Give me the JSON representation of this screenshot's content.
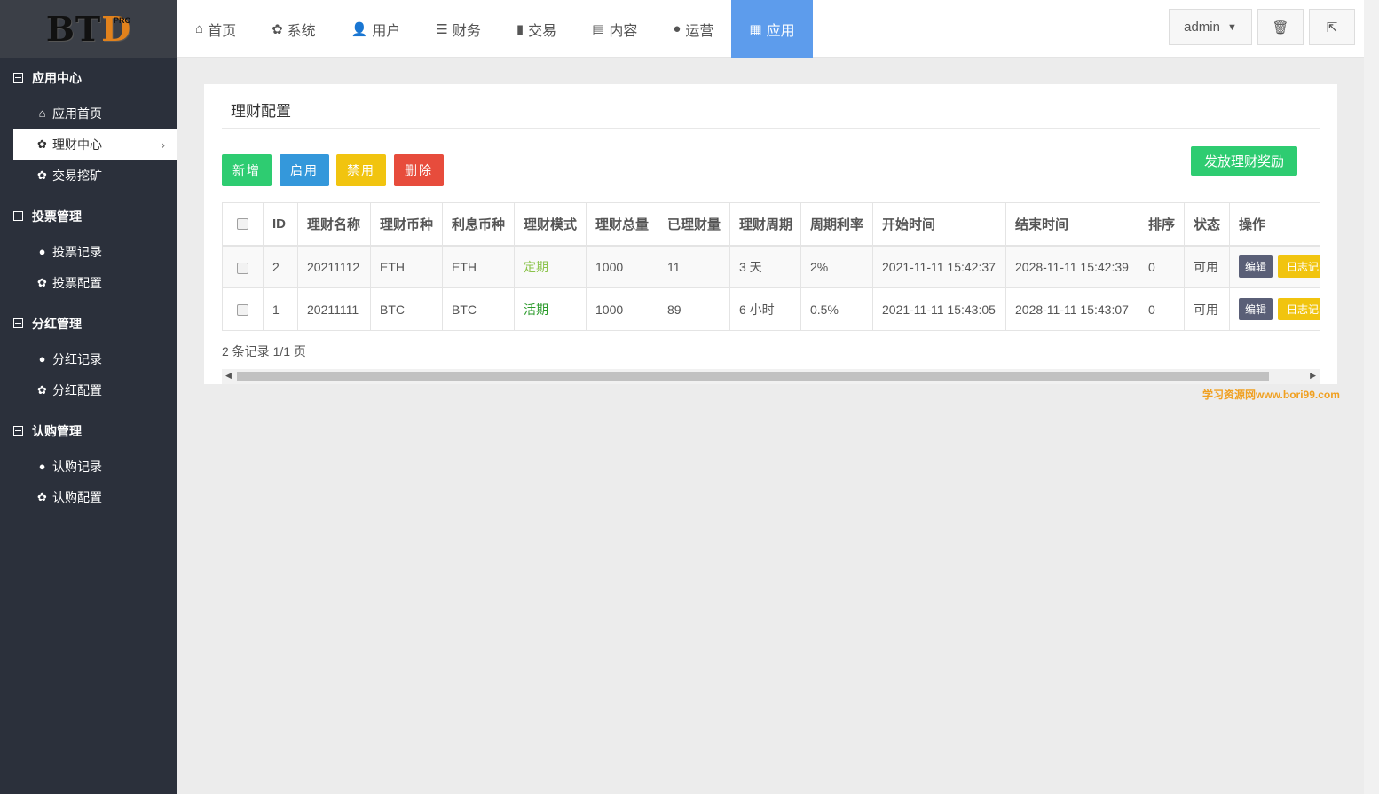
{
  "brand": {
    "logo_main": "BT",
    "logo_d": "D",
    "logo_sup": "PRO"
  },
  "sidebar": {
    "groups": [
      {
        "title": "应用中心",
        "items": [
          {
            "icon": "home-icon",
            "glyph": "⌂",
            "label": "应用首页"
          },
          {
            "icon": "gear-icon",
            "glyph": "✿",
            "label": "理财中心",
            "active": true
          },
          {
            "icon": "gear-icon",
            "glyph": "✿",
            "label": "交易挖矿"
          }
        ]
      },
      {
        "title": "投票管理",
        "items": [
          {
            "icon": "globe-icon",
            "glyph": "●",
            "label": "投票记录"
          },
          {
            "icon": "gear-icon",
            "glyph": "✿",
            "label": "投票配置"
          }
        ]
      },
      {
        "title": "分红管理",
        "items": [
          {
            "icon": "globe-icon",
            "glyph": "●",
            "label": "分红记录"
          },
          {
            "icon": "gear-icon",
            "glyph": "✿",
            "label": "分红配置"
          }
        ]
      },
      {
        "title": "认购管理",
        "items": [
          {
            "icon": "globe-icon",
            "glyph": "●",
            "label": "认购记录"
          },
          {
            "icon": "gear-icon",
            "glyph": "✿",
            "label": "认购配置"
          }
        ]
      }
    ]
  },
  "topnav": [
    {
      "glyph": "⌂",
      "icon": "home-icon",
      "label": "首页"
    },
    {
      "glyph": "✿",
      "icon": "gear-icon",
      "label": "系统"
    },
    {
      "glyph": "👤",
      "icon": "user-icon",
      "label": "用户"
    },
    {
      "glyph": "☰",
      "icon": "list-icon",
      "label": "财务"
    },
    {
      "glyph": "▮",
      "icon": "bar-chart-icon",
      "label": "交易"
    },
    {
      "glyph": "▤",
      "icon": "document-icon",
      "label": "内容"
    },
    {
      "glyph": "●",
      "icon": "globe-icon",
      "label": "运营"
    },
    {
      "glyph": "▦",
      "icon": "grid-icon",
      "label": "应用",
      "active": true
    }
  ],
  "header": {
    "admin_label": "admin",
    "caret": "▼",
    "trash_glyph": "🗑",
    "logout_glyph": "⇱"
  },
  "panel": {
    "title": "理财配置",
    "buttons": {
      "add": "新增",
      "enable": "启用",
      "disable": "禁用",
      "delete": "删除",
      "reward": "发放理财奖励"
    },
    "columns": [
      "ID",
      "理财名称",
      "理财币种",
      "利息币种",
      "理财模式",
      "理财总量",
      "已理财量",
      "理财周期",
      "周期利率",
      "开始时间",
      "结束时间",
      "排序",
      "状态",
      "操作"
    ],
    "rows": [
      {
        "id": "2",
        "name": "20211112",
        "coin": "ETH",
        "interest_coin": "ETH",
        "mode": "定期",
        "mode_type": "fixed",
        "total": "1000",
        "done": "11",
        "period": "3 天",
        "rate": "2%",
        "start": "2021-11-11 15:42:37",
        "end": "2028-11-11 15:42:39",
        "sort": "0",
        "status": "可用",
        "edit": "编辑",
        "log": "日志记录"
      },
      {
        "id": "1",
        "name": "20211111",
        "coin": "BTC",
        "interest_coin": "BTC",
        "mode": "活期",
        "mode_type": "live",
        "total": "1000",
        "done": "89",
        "period": "6 小时",
        "rate": "0.5%",
        "start": "2021-11-11 15:43:05",
        "end": "2028-11-11 15:43:07",
        "sort": "0",
        "status": "可用",
        "edit": "编辑",
        "log": "日志记录"
      }
    ],
    "pager": "2 条记录 1/1 页"
  },
  "watermark": "学习资源网www.bori99.com"
}
